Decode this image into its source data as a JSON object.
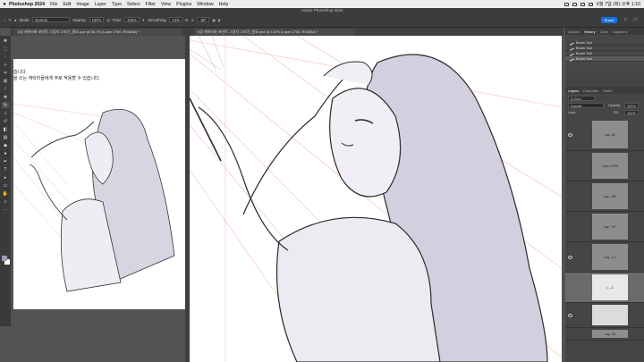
{
  "menubar": {
    "app_name": "Photoshop 2024",
    "items": [
      "File",
      "Edit",
      "Image",
      "Layer",
      "Type",
      "Select",
      "Filter",
      "View",
      "Plugins",
      "Window",
      "Help"
    ],
    "clock": "6월 7일 (화) 오후 1:10"
  },
  "window": {
    "title": "Adobe Photoshop 2024"
  },
  "options": {
    "mode_label": "Mode:",
    "mode_value": "Normal",
    "opacity_label": "Opacity:",
    "opacity_value": "100%",
    "flow_label": "Flow:",
    "flow_value": "100%",
    "smoothing_label": "Smoothing:",
    "smoothing_value": "10%",
    "angle_value": "-60°",
    "share_label": "Share"
  },
  "documents": [
    {
      "label": "6강 캐릭터와 포인트 그림자 그리기_필요.psd @ 66.7% (Layer 2760, RGB/8#) *"
    },
    {
      "label": "6강 캐릭터와 포인트 그림자 그리기_필요.psd @ 142% (Layer 2760, RGB/8#) *"
    }
  ],
  "canvas_text": {
    "line1": "습니다.",
    "line2": "을 쓰는 캐릭터들에게 주로 적용할 수 있습니다."
  },
  "panels": {
    "top_tabs": [
      "Actions",
      "History",
      "Color",
      "Adjustme"
    ],
    "history": [
      "Brush Tool",
      "Brush Tool",
      "Brush Tool",
      "Brush Tool"
    ],
    "layer_tabs": [
      "Layers",
      "Channels",
      "Paths"
    ],
    "kind_label": "Q Kind",
    "blend_mode": "Normal",
    "opacity_label": "Opacity:",
    "opacity_value": "100%",
    "lock_label": "Lock:",
    "fill_label": "Fill:",
    "fill_value": "100%",
    "layers": [
      "Lay...60",
      "Layer 2759",
      "Lay...760",
      "Lay...757",
      "Lay...x 1",
      "L...3",
      "",
      "Lay...83"
    ]
  },
  "colors": {
    "accent": "#1473e6",
    "foreground": "#a79ab8",
    "background": "#ffffff"
  }
}
